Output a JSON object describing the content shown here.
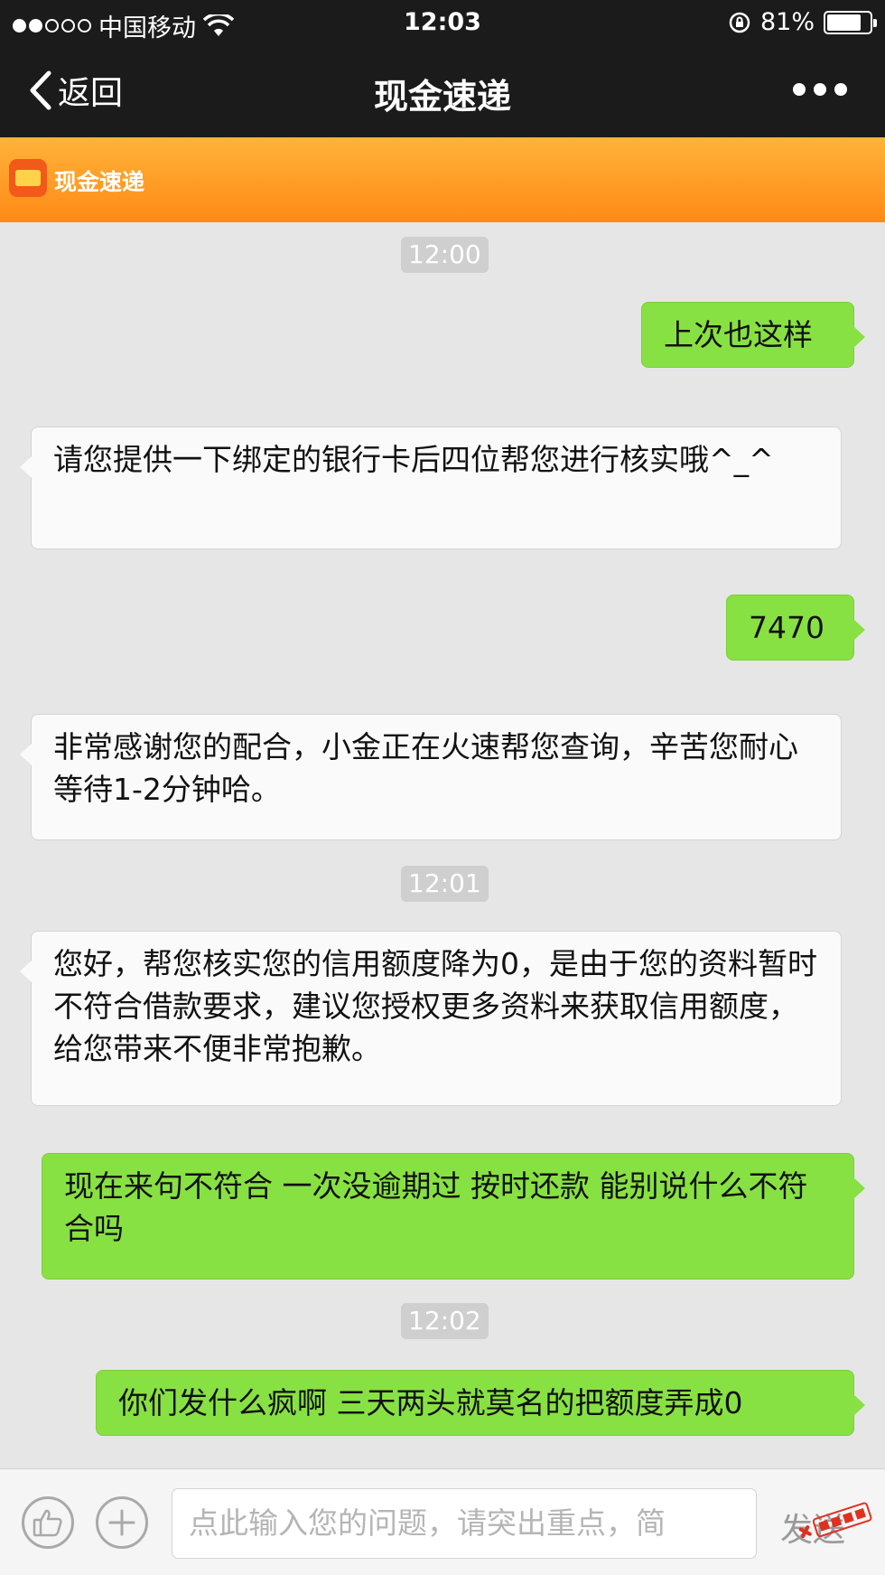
{
  "status_bar": {
    "carrier": "中国移动",
    "time": "12:03",
    "battery": "81%",
    "battery_level": 0.81
  },
  "nav": {
    "back_label": "返回",
    "title": "现金速递"
  },
  "banner": {
    "brand": "现金速递"
  },
  "messages": {
    "t1": "12:00",
    "m1": "上次也这样",
    "m2": "请您提供一下绑定的银行卡后四位帮您进行核实哦^_^",
    "m3": "7470",
    "m4": "非常感谢您的配合，小金正在火速帮您查询，辛苦您耐心等待1-2分钟哈。",
    "t2": "12:01",
    "m5": "您好，帮您核实您的信用额度降为0，是由于您的资料暂时不符合借款要求，建议您授权更多资料来获取信用额度，给您带来不便非常抱歉。",
    "m6": "现在来句不符合 一次没逾期过 按时还款 能别说什么不符合吗",
    "t3": "12:02",
    "m7": "你们发什么疯啊 三天两头就莫名的把额度弄成0"
  },
  "input_bar": {
    "placeholder": "点此输入您的问题，请突出重点，简",
    "send_label": "发送"
  },
  "icons": {
    "like": "thumbs-up-icon",
    "add": "plus-icon",
    "back": "chevron-left-icon",
    "more": "more-icon"
  },
  "colors": {
    "outgoing_bubble": "#88e142",
    "incoming_bubble": "#fafafa",
    "banner": "#ff9a24",
    "navbar": "#1b1b1b"
  }
}
